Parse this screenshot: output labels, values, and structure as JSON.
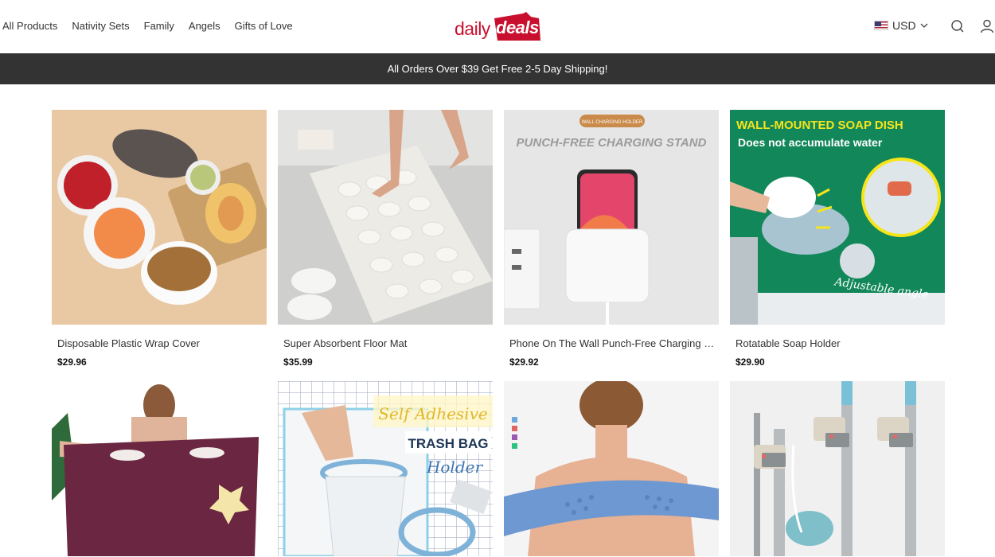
{
  "nav": {
    "items": [
      {
        "label": "All Products"
      },
      {
        "label": "Nativity Sets"
      },
      {
        "label": "Family"
      },
      {
        "label": "Angels"
      },
      {
        "label": "Gifts of Love"
      }
    ]
  },
  "logo": {
    "daily": "daily",
    "deals": "deals"
  },
  "currency": {
    "label": "USD",
    "flag_icon": "us-flag-icon"
  },
  "header_icons": {
    "search": "search-icon",
    "account": "user-icon"
  },
  "announcement": "All Orders Over $39 Get Free 2-5 Day Shipping!",
  "colors": {
    "brand": "#c8102e",
    "announce_bg": "#333333"
  },
  "products": [
    {
      "title": "Disposable Plastic Wrap Cover",
      "price": "$29.96"
    },
    {
      "title": "Super Absorbent Floor Mat",
      "price": "$35.99"
    },
    {
      "title": "Phone On The Wall Punch-Free Charging Stand",
      "price": "$29.92",
      "image_text": {
        "badge": "WALL CHARGING HOLDER",
        "headline": "PUNCH-FREE CHARGING STAND"
      }
    },
    {
      "title": "Rotatable Soap Holder",
      "price": "$29.90",
      "image_text": {
        "headline": "WALL-MOUNTED SOAP DISH",
        "sub": "Does not accumulate water",
        "caption": "Adjustable angle"
      }
    },
    {
      "title": "",
      "price": ""
    },
    {
      "title": "",
      "price": "",
      "image_text": {
        "line1": "Self Adhesive",
        "line2": "TRASH BAG",
        "line3": "Holder"
      }
    },
    {
      "title": "",
      "price": ""
    },
    {
      "title": "",
      "price": ""
    }
  ]
}
